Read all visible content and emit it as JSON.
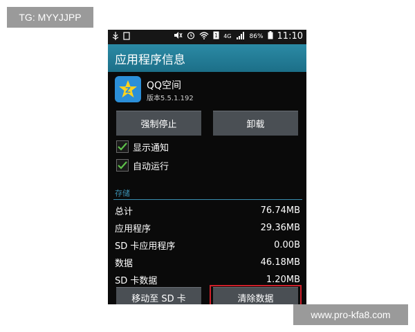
{
  "watermarks": {
    "top": "TG: MYYJJPP",
    "bottom": "www.pro-kfa8.com"
  },
  "status_bar": {
    "battery": "86%",
    "time": "11:10",
    "network": "4G",
    "icons": [
      "usb-icon",
      "image-icon",
      "mute-icon",
      "alarm-icon",
      "wifi-icon",
      "sim-icon",
      "signal-icon",
      "battery-icon"
    ]
  },
  "title_bar": {
    "title": "应用程序信息"
  },
  "app": {
    "name": "QQ空间",
    "version": "版本5.5.1.192",
    "icon": "qzone-star-icon",
    "icon_color": "#2b8fd8"
  },
  "buttons": {
    "force_stop": "强制停止",
    "uninstall": "卸载",
    "move_to_sd": "移动至 SD 卡",
    "clear_data": "清除数据"
  },
  "checkboxes": [
    {
      "label": "显示通知",
      "checked": true
    },
    {
      "label": "自动运行",
      "checked": true
    }
  ],
  "storage": {
    "section_label": "存储",
    "rows": [
      {
        "label": "总计",
        "value": "76.74MB"
      },
      {
        "label": "应用程序",
        "value": "29.36MB"
      },
      {
        "label": "SD 卡应用程序",
        "value": "0.00B"
      },
      {
        "label": "数据",
        "value": "46.18MB"
      },
      {
        "label": "SD 卡数据",
        "value": "1.20MB"
      }
    ]
  },
  "colors": {
    "accent": "#2b8aa5",
    "check": "#5ec24a",
    "highlight": "#d0202a"
  }
}
